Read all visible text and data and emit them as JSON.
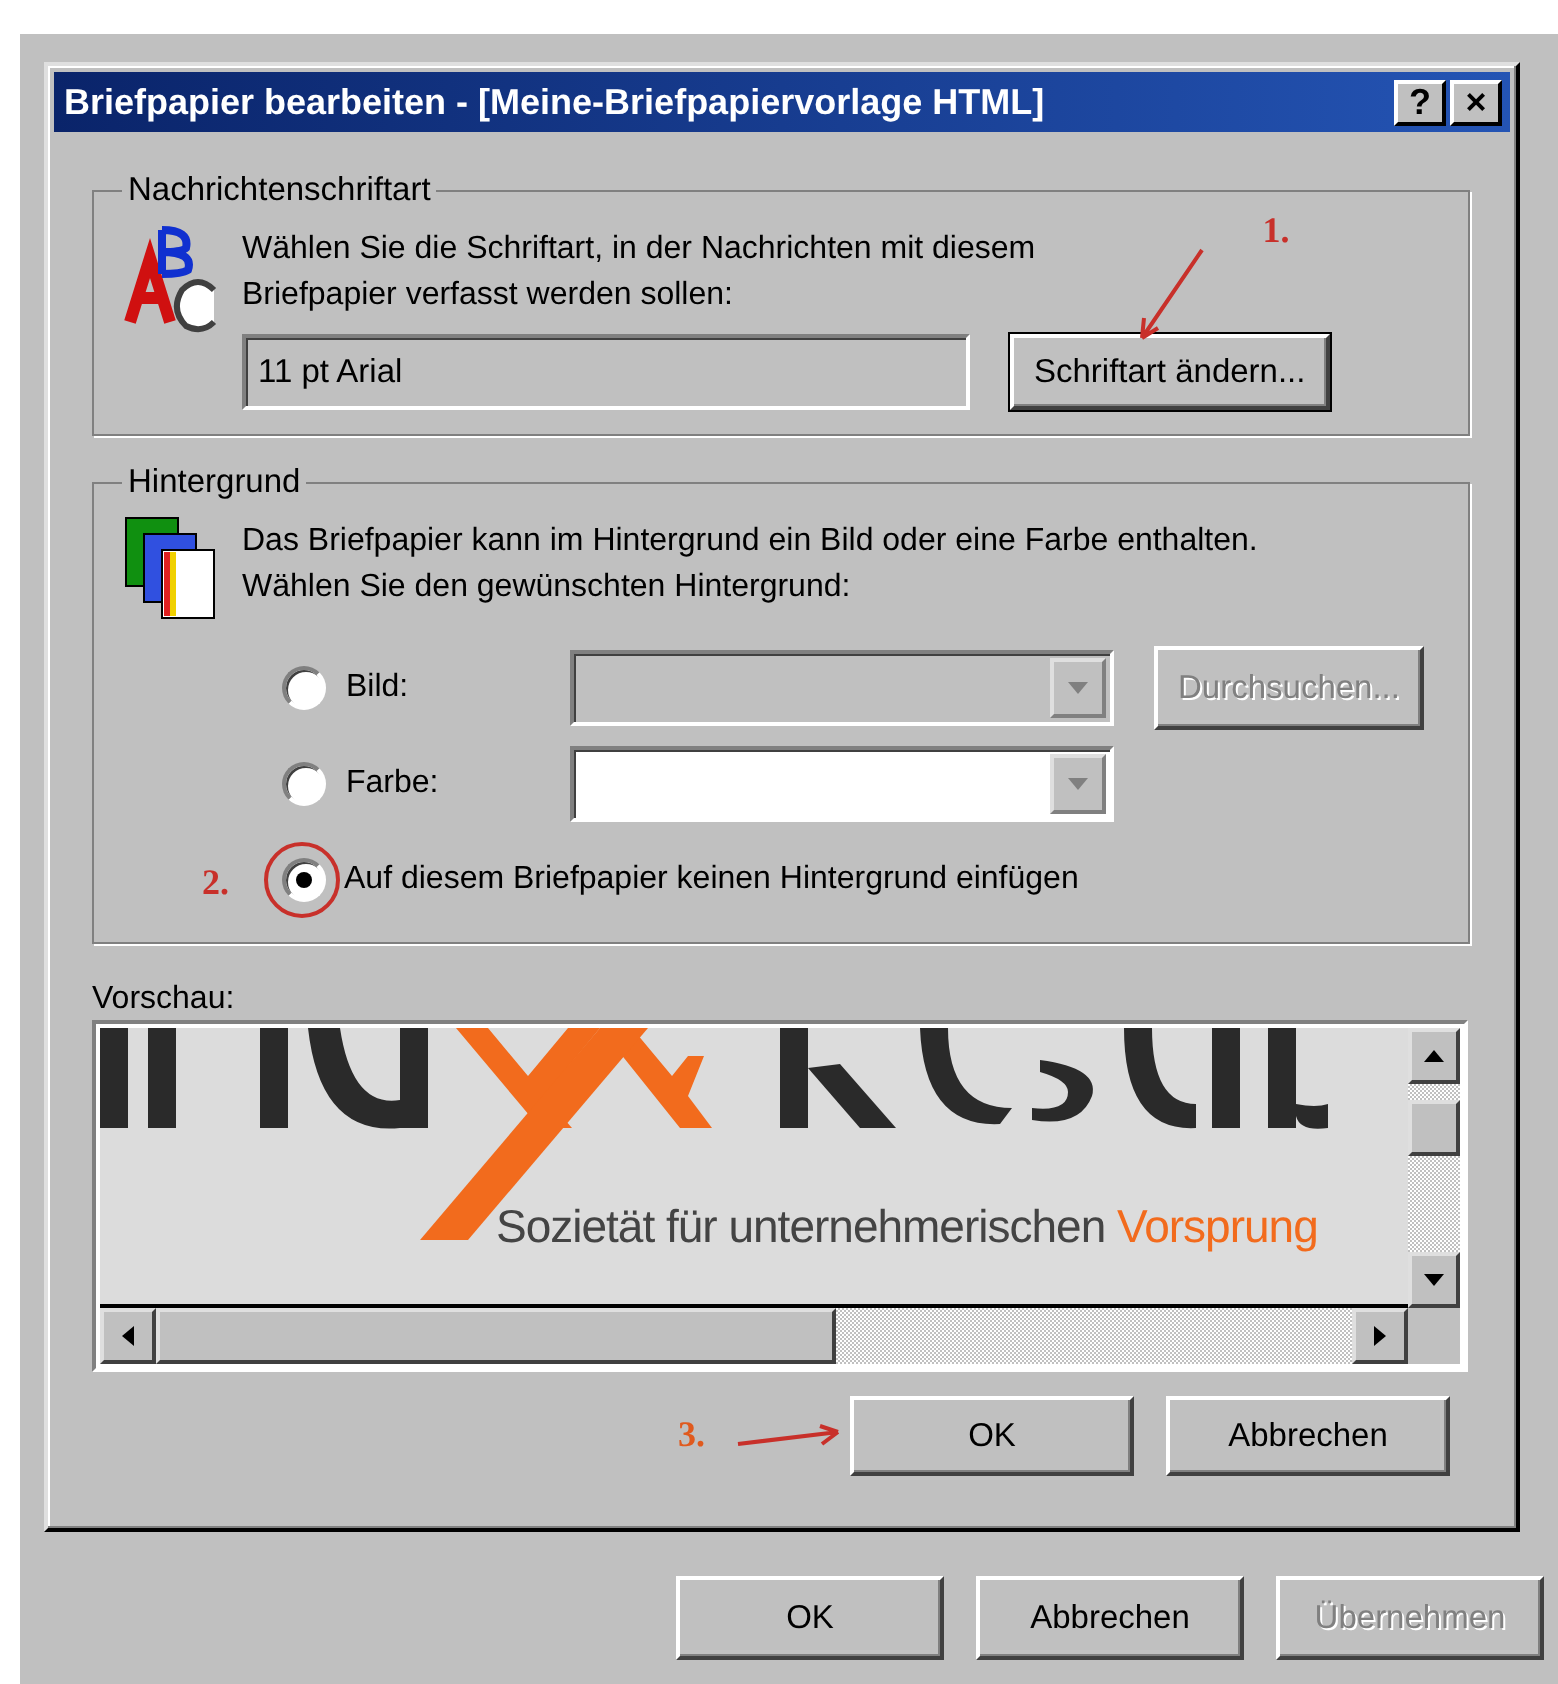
{
  "dialog": {
    "title": "Briefpapier bearbeiten - [Meine-Briefpapiervorlage HTML]",
    "help_button": "?",
    "close_button": "×"
  },
  "font_group": {
    "legend": "Nachrichtenschriftart",
    "description": "Wählen Sie die Schriftart, in der Nachrichten mit diesem Briefpapier verfasst werden sollen:",
    "font_value": "11 pt Arial",
    "button": {
      "label": "Schriftart ändern...",
      "step": "1."
    }
  },
  "background_group": {
    "legend": "Hintergrund",
    "description": "Das Briefpapier kann im Hintergrund ein Bild oder eine Farbe enthalten. Wählen Sie den gewünschten Hintergrund:",
    "options": [
      {
        "kind": "picture",
        "label": "Bild:",
        "selected": false,
        "combo_disabled": true,
        "browse": {
          "label": "Durchsuchen...",
          "disabled": true
        }
      },
      {
        "kind": "color",
        "label": "Farbe:",
        "selected": false,
        "combo_disabled": false
      },
      {
        "kind": "none",
        "label": "Auf diesem Briefpapier keinen Hintergrund einfügen",
        "selected": true,
        "step": "2."
      }
    ]
  },
  "preview": {
    "label": "Vorschau:",
    "tagline": "Sozietät für unternehmerischen",
    "tagline_highlight": "Vorsprung"
  },
  "dialog_buttons": [
    {
      "label": "OK",
      "step": "3.",
      "disabled": false
    },
    {
      "label": "Abbrechen",
      "disabled": false
    }
  ],
  "parent_buttons": [
    {
      "label": "OK",
      "disabled": false
    },
    {
      "label": "Abbrechen",
      "disabled": false
    },
    {
      "label": "Übernehmen",
      "disabled": true
    }
  ]
}
